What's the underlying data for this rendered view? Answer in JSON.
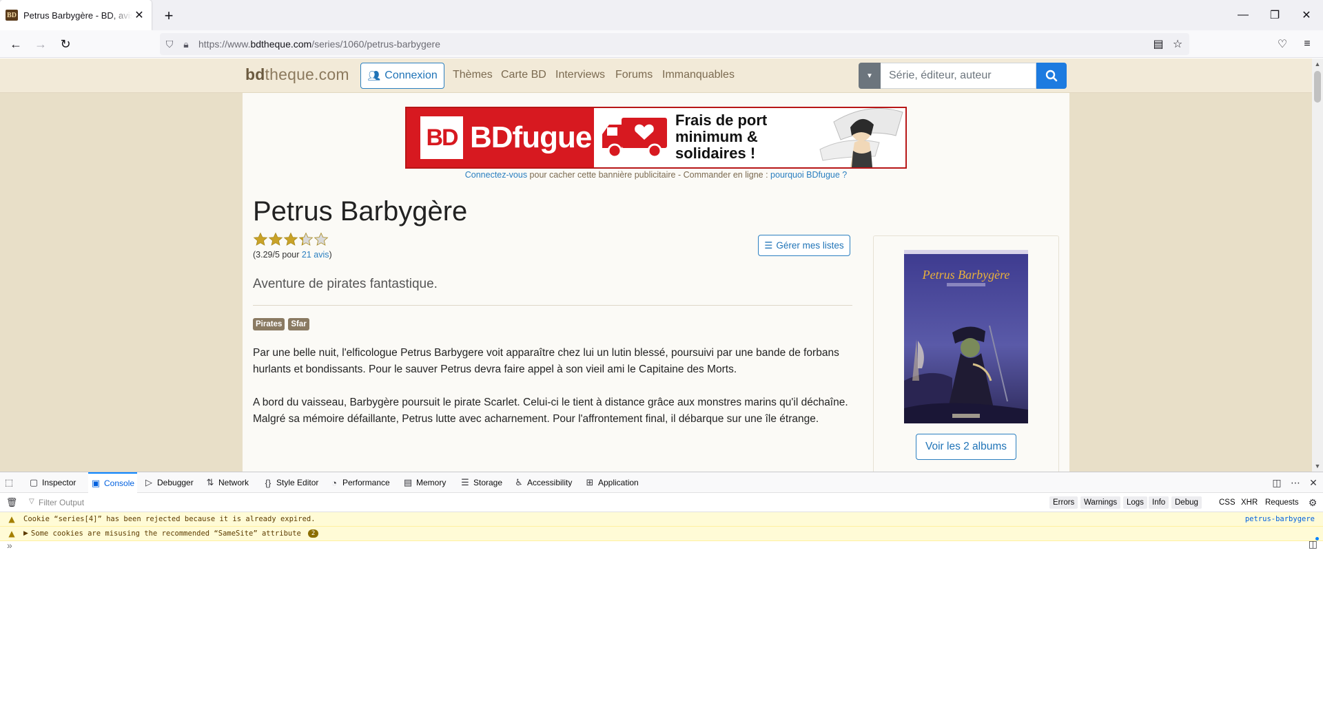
{
  "browser": {
    "tab_title": "Petrus Barbygère - BD, avis, informations",
    "favicon_text": "BD",
    "url_prefix": "https://www.",
    "url_host": "bdtheque.com",
    "url_path": "/series/1060/petrus-barbygere"
  },
  "site": {
    "logo_bold": "bd",
    "logo_rest": "theque.com",
    "login_label": "Connexion",
    "nav": [
      "Thèmes",
      "Carte BD",
      "Interviews",
      "Forums",
      "Immanquables"
    ],
    "search_placeholder": "Série, éditeur, auteur"
  },
  "ad": {
    "logo_mark": "BD",
    "brand": "BDfugue",
    "line1": "Frais de port",
    "line2": "minimum &",
    "line3": "solidaires !",
    "note_link1": "Connectez-vous",
    "note_middle": " pour cacher cette bannière publicitaire - Commander en ligne : ",
    "note_link2": "pourquoi BDfugue ?"
  },
  "series": {
    "title": "Petrus Barbygère",
    "rating": 3.29,
    "rating_max": 5,
    "rating_prefix": "(3.29/5 pour ",
    "reviews_link": "21 avis",
    "rating_suffix": ")",
    "manage_lists_label": "Gérer mes listes",
    "tagline": "Aventure de pirates fantastique.",
    "tags": [
      "Pirates",
      "Sfar"
    ],
    "desc_p1": "Par une belle nuit, l'elficologue Petrus Barbygere voit apparaître chez lui un lutin blessé, poursuivi par une bande de forbans hurlants et bondissants. Pour le sauver Petrus devra faire appel à son vieil ami le Capitaine des Morts.",
    "desc_p2": "A bord du vaisseau, Barbygère poursuit le pirate Scarlet. Celui-ci le tient à distance grâce aux monstres marins qu'il déchaîne. Malgré sa mémoire défaillante, Petrus lutte avec acharnement. Pour l'affrontement final, il débarque sur une île étrange.",
    "cover_title": "Petrus Barbygère",
    "albums_button": "Voir les 2 albums"
  },
  "devtools": {
    "tabs": [
      "Inspector",
      "Console",
      "Debugger",
      "Network",
      "Style Editor",
      "Performance",
      "Memory",
      "Storage",
      "Accessibility",
      "Application"
    ],
    "active_tab": "Console",
    "filter_placeholder": "Filter Output",
    "filters": [
      "Errors",
      "Warnings",
      "Logs",
      "Info",
      "Debug"
    ],
    "filters_plain": [
      "CSS",
      "XHR",
      "Requests"
    ],
    "messages": [
      {
        "text": "Cookie “series[4]” has been rejected because it is already expired.",
        "source": "petrus-barbygere"
      },
      {
        "text": "Some cookies are misusing the recommended “SameSite” attribute",
        "count": "2"
      }
    ],
    "prompt": "»"
  }
}
